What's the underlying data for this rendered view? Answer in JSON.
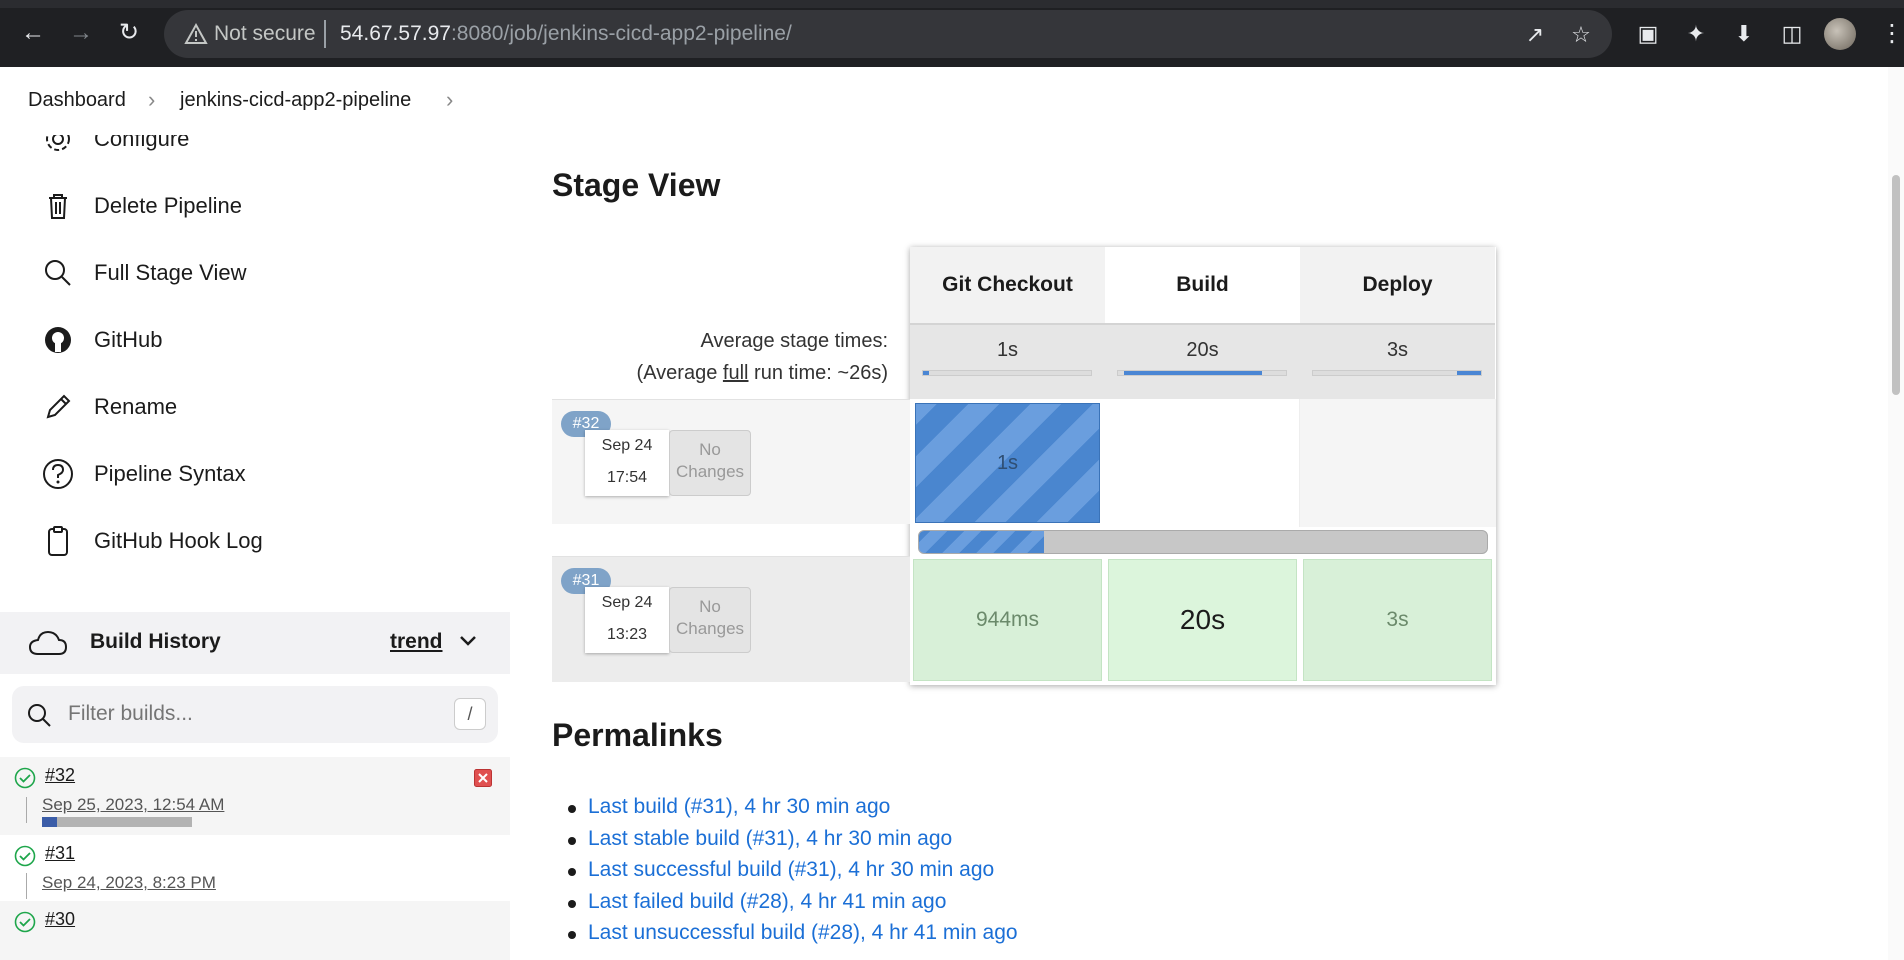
{
  "browser": {
    "security_label": "Not secure",
    "url_host": "54.67.57.97",
    "url_path": ":8080/job/jenkins-cicd-app2-pipeline/"
  },
  "breadcrumb": {
    "items": [
      "Dashboard",
      "jenkins-cicd-app2-pipeline"
    ]
  },
  "sidebar": {
    "items": [
      {
        "label": "Configure",
        "icon": "gear-icon"
      },
      {
        "label": "Delete Pipeline",
        "icon": "trash-icon"
      },
      {
        "label": "Full Stage View",
        "icon": "search-icon"
      },
      {
        "label": "GitHub",
        "icon": "github-icon"
      },
      {
        "label": "Rename",
        "icon": "pencil-icon"
      },
      {
        "label": "Pipeline Syntax",
        "icon": "help-icon"
      },
      {
        "label": "GitHub Hook Log",
        "icon": "clipboard-icon"
      }
    ]
  },
  "build_history": {
    "title": "Build History",
    "trend_label": "trend",
    "filter_placeholder": "Filter builds...",
    "filter_shortcut": "/",
    "builds": [
      {
        "number": "#32",
        "date": "Sep 25, 2023, 12:54 AM",
        "progress": 0.1
      },
      {
        "number": "#31",
        "date": "Sep 24, 2023, 8:23 PM"
      },
      {
        "number": "#30"
      }
    ]
  },
  "stage_view": {
    "title": "Stage View",
    "stages": [
      "Git Checkout",
      "Build",
      "Deploy"
    ],
    "avg_label_line1": "Average stage times:",
    "avg_label_line2_pre": "(Average ",
    "avg_label_line2_ul": "full",
    "avg_label_line2_post": " run time: ~26s)",
    "avg_times": [
      "1s",
      "20s",
      "3s"
    ],
    "runs": [
      {
        "badge": "#32",
        "date": "Sep 24",
        "time": "17:54",
        "changes": "No Changes",
        "cells": [
          "1s",
          "",
          ""
        ],
        "progress": 0.22
      },
      {
        "badge": "#31",
        "date": "Sep 24",
        "time": "13:23",
        "changes": "No Changes",
        "cells": [
          "944ms",
          "20s",
          "3s"
        ]
      }
    ]
  },
  "permalinks": {
    "title": "Permalinks",
    "links": [
      "Last build (#31), 4 hr 30 min ago",
      "Last stable build (#31), 4 hr 30 min ago",
      "Last successful build (#31), 4 hr 30 min ago",
      "Last failed build (#28), 4 hr 41 min ago",
      "Last unsuccessful build (#28), 4 hr 41 min ago"
    ]
  }
}
